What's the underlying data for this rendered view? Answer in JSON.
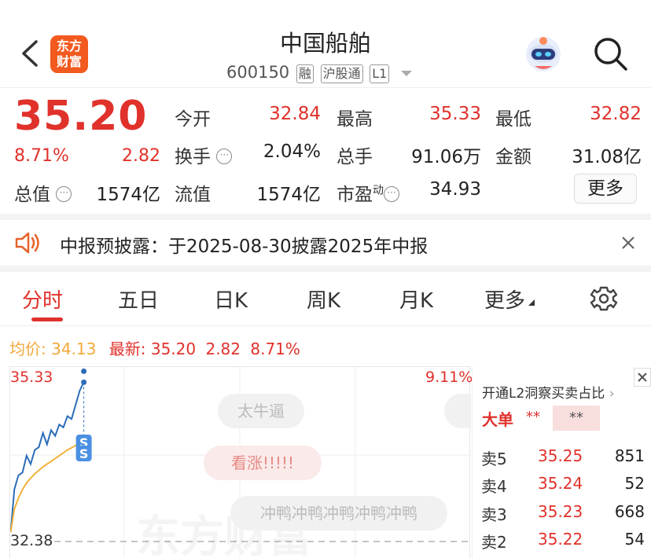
{
  "header": {
    "back_icon": "chevron-left-icon",
    "logo_text_line1": "东方",
    "logo_text_line2": "财富",
    "title": "中国船舶",
    "code": "600150",
    "tags": [
      "融",
      "沪股通",
      "L1"
    ],
    "robot_icon": "robot-avatar-icon",
    "search_icon": "search-icon"
  },
  "quote": {
    "price": "35.20",
    "change_pct": "8.71%",
    "change_amt": "2.82",
    "total_value_label": "总值",
    "total_value": "1574亿",
    "open_label": "今开",
    "open": "32.84",
    "turnover_label": "换手",
    "turnover": "2.04%",
    "float_label": "流值",
    "float_value": "1574亿",
    "high_label": "最高",
    "high": "35.33",
    "volume_label": "总手",
    "volume": "91.06万",
    "pe_label": "市盈",
    "pe_sup": "动",
    "pe": "34.93",
    "low_label": "最低",
    "low": "32.82",
    "amount_label": "金额",
    "amount": "31.08亿",
    "more_label": "更多"
  },
  "notice": {
    "text": "中报预披露：于2025-08-30披露2025年中报"
  },
  "tabs": [
    {
      "label": "分时",
      "active": true
    },
    {
      "label": "五日"
    },
    {
      "label": "日K"
    },
    {
      "label": "周K"
    },
    {
      "label": "月K"
    },
    {
      "label": "更多"
    }
  ],
  "summary": {
    "avg_label": "均价:",
    "avg": "34.13",
    "latest_label": "最新:",
    "latest": "35.20",
    "chg": "2.82",
    "pct": "8.71%"
  },
  "chart": {
    "y_max_label": "35.33",
    "y_min_label": "32.38",
    "pct_max_label": "9.11%",
    "bubbles": [
      "太牛逼",
      "看涨!!!!!",
      "冲鸭冲鸭冲鸭冲鸭冲鸭"
    ],
    "marker_label": "S",
    "watermark": "东方财富",
    "colors": {
      "price_line": "#2b6cb8",
      "avg_line": "#f2b23c",
      "up": "#e0312b"
    }
  },
  "chart_data": {
    "type": "line",
    "ylim": [
      32.38,
      35.33
    ],
    "series": [
      {
        "name": "最新",
        "values": [
          32.45,
          33.3,
          33.55,
          33.6,
          33.9,
          33.75,
          34.0,
          34.05,
          34.3,
          34.1,
          34.35,
          34.25,
          34.45,
          34.4,
          34.6,
          34.55,
          34.8,
          35.05,
          35.2
        ]
      },
      {
        "name": "均价",
        "values": [
          32.5,
          32.95,
          33.15,
          33.3,
          33.42,
          33.5,
          33.58,
          33.64,
          33.7,
          33.75,
          33.8,
          33.85,
          33.9,
          33.95,
          34.0,
          34.04,
          34.08,
          34.11,
          34.13
        ]
      }
    ]
  },
  "order_book": {
    "header": "开通L2洞察买卖占比",
    "big_order_label": "大单",
    "big_order_buy": "**",
    "big_order_sell": "**",
    "rows": [
      {
        "label": "卖5",
        "price": "35.25",
        "vol": "851"
      },
      {
        "label": "卖4",
        "price": "35.24",
        "vol": "52"
      },
      {
        "label": "卖3",
        "price": "35.23",
        "vol": "668"
      },
      {
        "label": "卖2",
        "price": "35.22",
        "vol": "54"
      }
    ]
  }
}
